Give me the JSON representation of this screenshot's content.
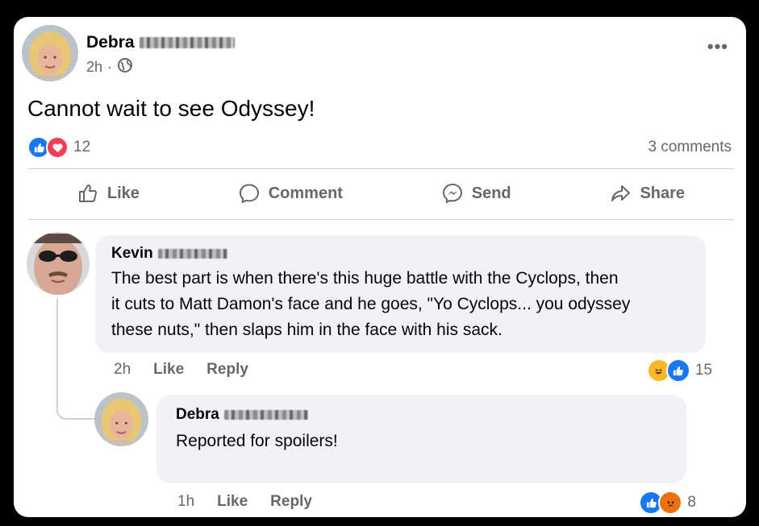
{
  "post": {
    "author_first": "Debra",
    "time": "2h",
    "separator": "·",
    "text": "Cannot wait to see Odyssey!",
    "reaction_count": "12",
    "comments_count": "3 comments",
    "more_glyph": "•••"
  },
  "actions": {
    "like": "Like",
    "comment": "Comment",
    "send": "Send",
    "share": "Share"
  },
  "comments": [
    {
      "author_first": "Kevin",
      "text_lines": [
        "The best part is when there's this huge battle with the Cyclops, then",
        "it cuts to Matt Damon's face and he goes, \"Yo Cyclops... you odyssey",
        "these nuts,\" then slaps him in the face with his sack."
      ],
      "time": "2h",
      "like": "Like",
      "reply": "Reply",
      "reaction_count": "15",
      "reactions": [
        "haha",
        "like"
      ]
    },
    {
      "author_first": "Debra",
      "text": "Reported for spoilers!",
      "time": "1h",
      "like": "Like",
      "reply": "Reply",
      "reaction_count": "8",
      "reactions": [
        "like",
        "angry"
      ]
    }
  ],
  "colors": {
    "like_blue": "#1877f2",
    "love_red": "#f33e58",
    "haha_yellow": "#f7b928",
    "angry_orange": "#e9710f",
    "muted_text": "#65676b",
    "bubble_bg": "#f0f2f5"
  },
  "icons": [
    "more-options-icon",
    "globe-icon",
    "like-reaction-icon",
    "love-reaction-icon",
    "thumbs-up-icon",
    "comment-icon",
    "messenger-icon",
    "share-arrow-icon",
    "haha-reaction-icon",
    "angry-reaction-icon"
  ]
}
